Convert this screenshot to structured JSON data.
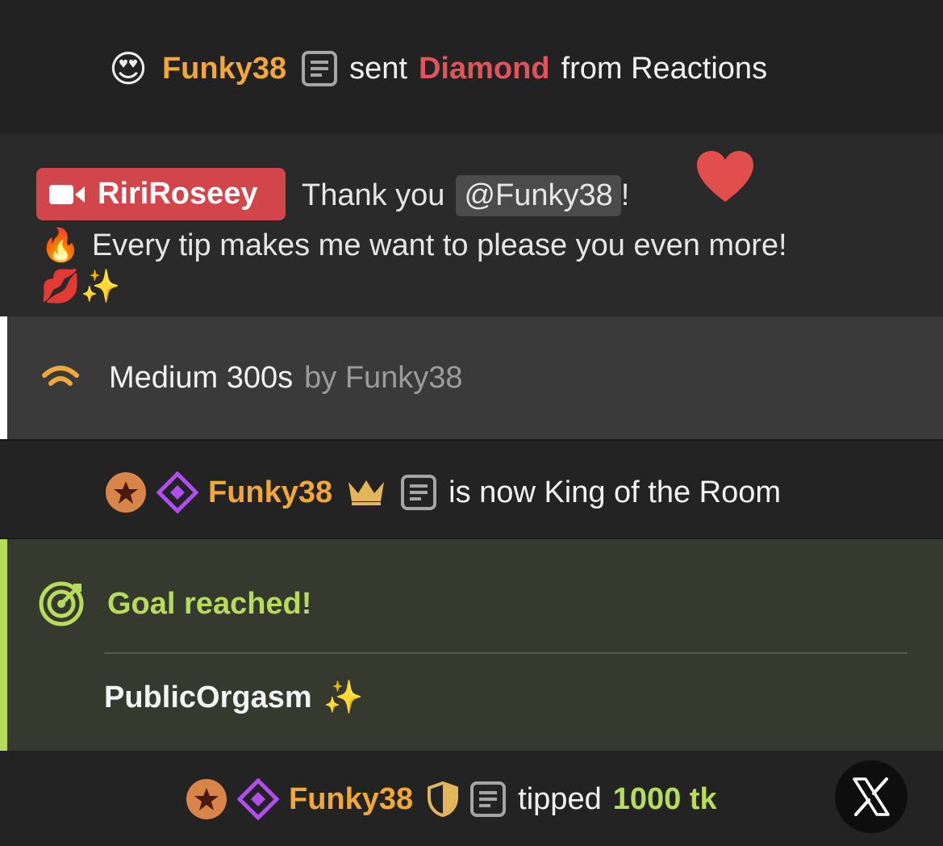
{
  "reaction": {
    "user": "Funky38",
    "verb": "sent",
    "item": "Diamond",
    "suffix": "from Reactions",
    "emoji": "😍"
  },
  "model_message": {
    "model_name": "RiriRoseey",
    "text_before": "Thank you",
    "mention": "@Funky38",
    "text_after": "!",
    "heart": "❤️",
    "line2_emoji": "🔥",
    "line2": "Every tip makes me want to please you even more!",
    "line3_emojis": "💋✨"
  },
  "toy": {
    "level": "Medium 300s",
    "by": "by Funky38"
  },
  "king": {
    "user": "Funky38",
    "text": "is now King of the Room"
  },
  "goal": {
    "title": "Goal reached!",
    "name": "PublicOrgasm",
    "sparkle": "✨"
  },
  "tip": {
    "user": "Funky38",
    "verb": "tipped",
    "amount": "1000 tk"
  },
  "colors": {
    "user": "#f2a73b",
    "diamond": "#e0555b",
    "model_badge": "#d2464b",
    "goal_accent": "#b6dc5c",
    "league_purple": "#b04cf0"
  }
}
